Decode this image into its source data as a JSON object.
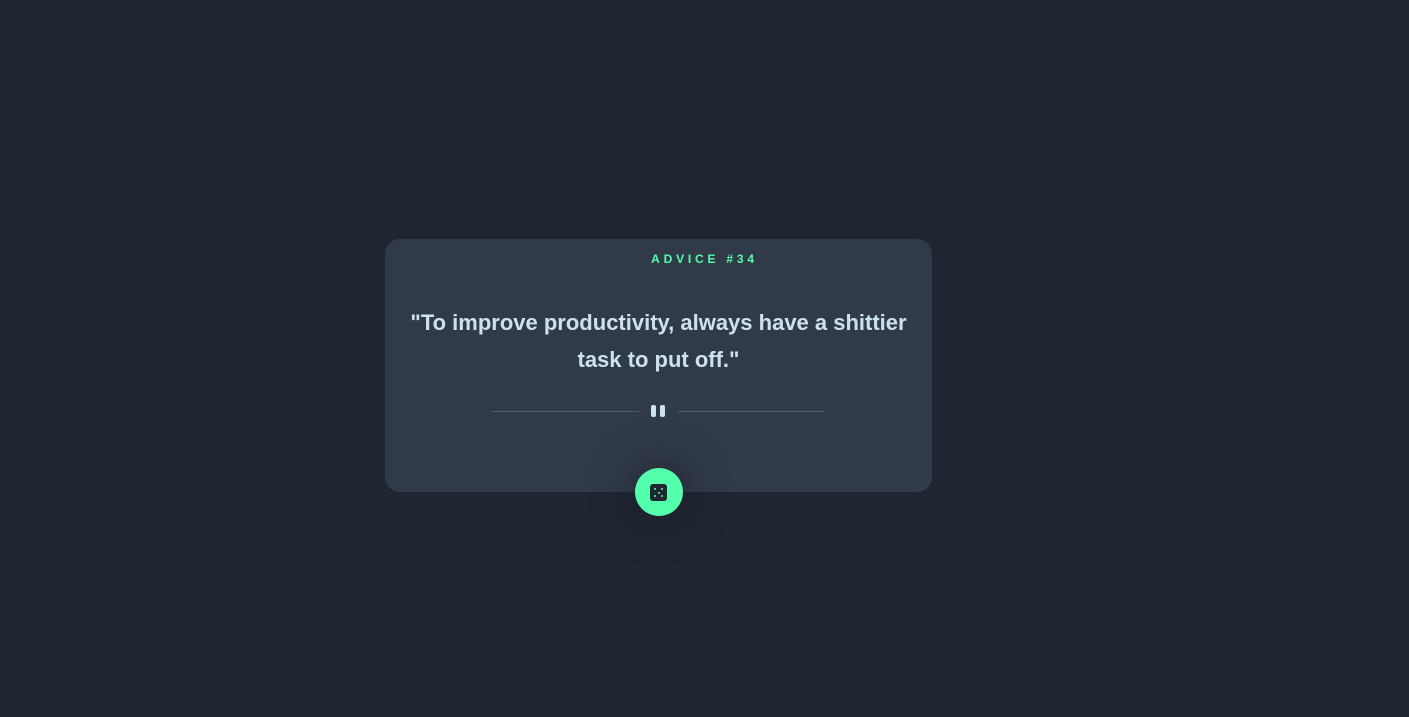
{
  "card": {
    "advice_label": "ADVICE #34",
    "quote": "\"To improve productivity, always have a shittier task to put off.\""
  },
  "icons": {
    "divider": "pause-icon",
    "button": "dice-icon"
  },
  "colors": {
    "background": "#1f2632",
    "card": "#313a48",
    "accent": "#53ffaa",
    "text": "#cee3e9",
    "divider": "#4f5d74"
  }
}
